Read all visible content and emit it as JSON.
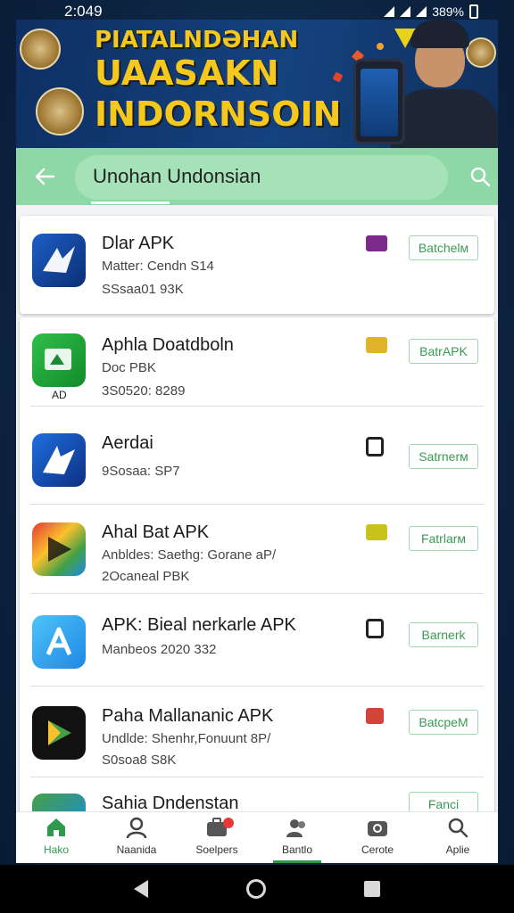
{
  "status_bar": {
    "time": "2:049",
    "battery": "389%"
  },
  "banner": {
    "line1": "PIATALNDƏHAN",
    "line2": "UAASAKN",
    "line3": "INDORNSOIN"
  },
  "header": {
    "title": "Unohan Undonsian"
  },
  "apps": [
    {
      "name": "Dlar APK",
      "line1": "Matter: Cendn S14",
      "line2": "SSsaa01 93K",
      "action": "Batchelм",
      "badge_color": "#7b2a8c"
    },
    {
      "name": "Aphla Doatdboln",
      "line1": "Doc PBK",
      "line2": "3S0520: 8289",
      "action": "BatrAPK",
      "badge_color": "#e0b42a",
      "ad": "AD"
    },
    {
      "name": "Aerdai",
      "line1": "9Sosaa: SP7",
      "line2": "",
      "action": "Satrnerм",
      "badge_color": "#222"
    },
    {
      "name": "Ahal Bat APK",
      "line1": "Anbldes: Saethg: Gorane aP/",
      "line2": "2Ocaneal PBK",
      "action": "Fatrlarм",
      "badge_color": "#c7c21c"
    },
    {
      "name": "APK: Bieal nerkarle APK",
      "line1": "Manbeos 2020 332",
      "line2": "",
      "action": "Barnerk",
      "badge_color": "#222"
    },
    {
      "name": "Paha Mallananic APK",
      "line1": "Undlde: Shenhr,Fonuunt 8P/",
      "line2": "S0soa8 S8K",
      "action": "BatcpeM",
      "badge_color": "#d2433a"
    },
    {
      "name": "Sahia Dndenstan",
      "line1": "",
      "line2": "",
      "action": "Fanci",
      "badge_color": "#222"
    }
  ],
  "bottom_nav": [
    {
      "label": "Hako",
      "icon": "home-icon",
      "active": true
    },
    {
      "label": "Naanida",
      "icon": "person-search-icon",
      "active": false
    },
    {
      "label": "Soelpers",
      "icon": "briefcase-icon",
      "active": false
    },
    {
      "label": "Bantlo",
      "icon": "people-icon",
      "active": false
    },
    {
      "label": "Cerote",
      "icon": "camera-icon",
      "active": false
    },
    {
      "label": "Aplie",
      "icon": "search-icon",
      "active": false
    }
  ],
  "colors": {
    "accent_green": "#2f9a4d",
    "header_green": "#8ed8a5",
    "banner_blue": "#14427e",
    "banner_yellow": "#f4c81c"
  }
}
